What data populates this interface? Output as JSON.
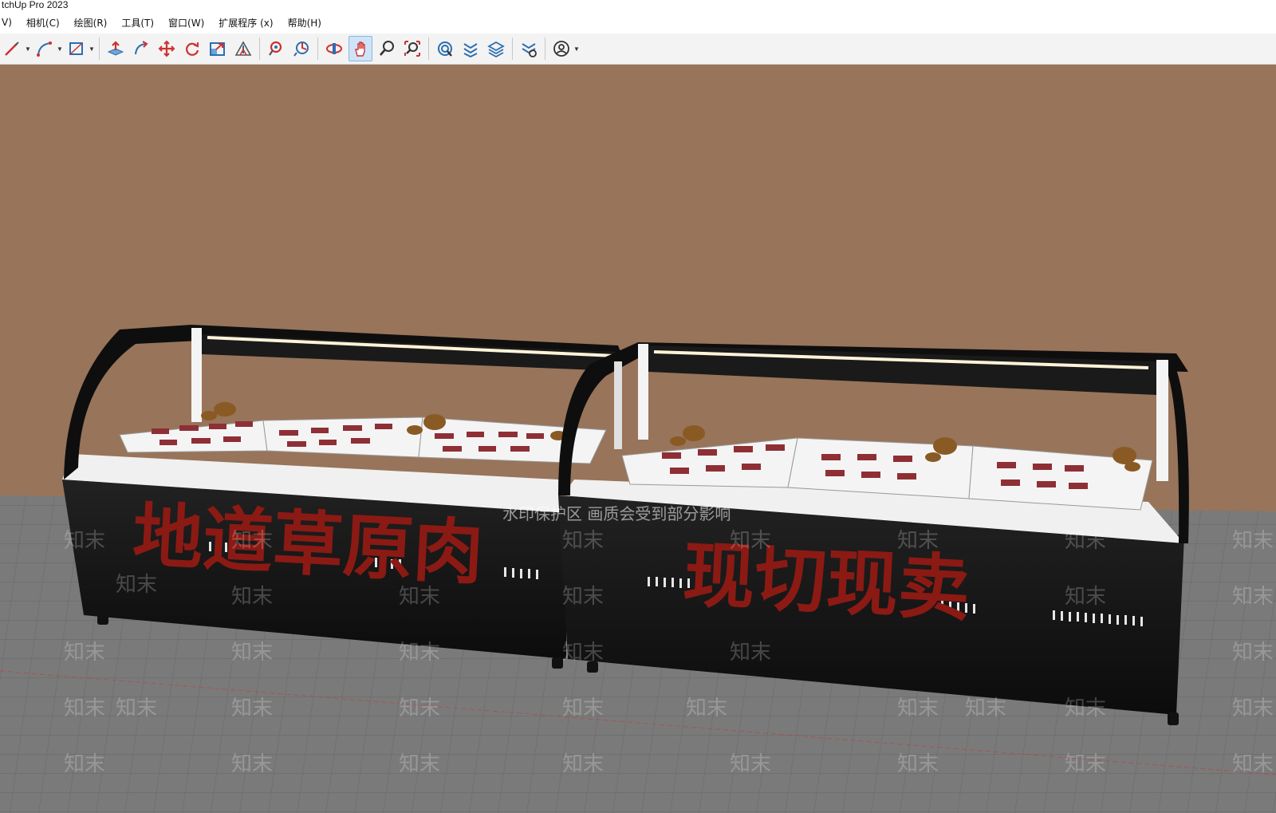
{
  "window": {
    "title": "tchUp Pro 2023"
  },
  "menu": [
    {
      "id": "view",
      "label": "V)"
    },
    {
      "id": "camera",
      "label": "相机(C)"
    },
    {
      "id": "draw",
      "label": "绘图(R)"
    },
    {
      "id": "tools",
      "label": "工具(T)"
    },
    {
      "id": "window",
      "label": "窗口(W)"
    },
    {
      "id": "extensions",
      "label": "扩展程序 (x)"
    },
    {
      "id": "help",
      "label": "帮助(H)"
    }
  ],
  "toolbar": {
    "tools": [
      "line-icon",
      "arc-icon",
      "rectangle-icon",
      "push-pull-icon",
      "follow-me-icon",
      "move-icon",
      "rotate-icon",
      "scale-icon",
      "offset-icon",
      "tape-measure-icon",
      "protractor-icon",
      "orbit-icon",
      "pan-icon",
      "zoom-icon",
      "zoom-extents-icon",
      "warehouse-icon",
      "extension-warehouse-icon",
      "layer-icon",
      "styles-icon",
      "account-icon"
    ],
    "active_tool": "pan-icon"
  },
  "scene": {
    "counter_left_sign": "地道草原肉",
    "counter_right_sign": "现切现卖",
    "watermark_banner": "水印保护区  画质会受到部分影响",
    "watermark_tile": "知末"
  },
  "colors": {
    "wall": "#98745a",
    "floor": "#7d7d7d",
    "counter_body": "#141414",
    "sign_red": "#8b1a14",
    "tray": "#f2f2f2",
    "active_tool_bg": "#cfe4f7"
  }
}
